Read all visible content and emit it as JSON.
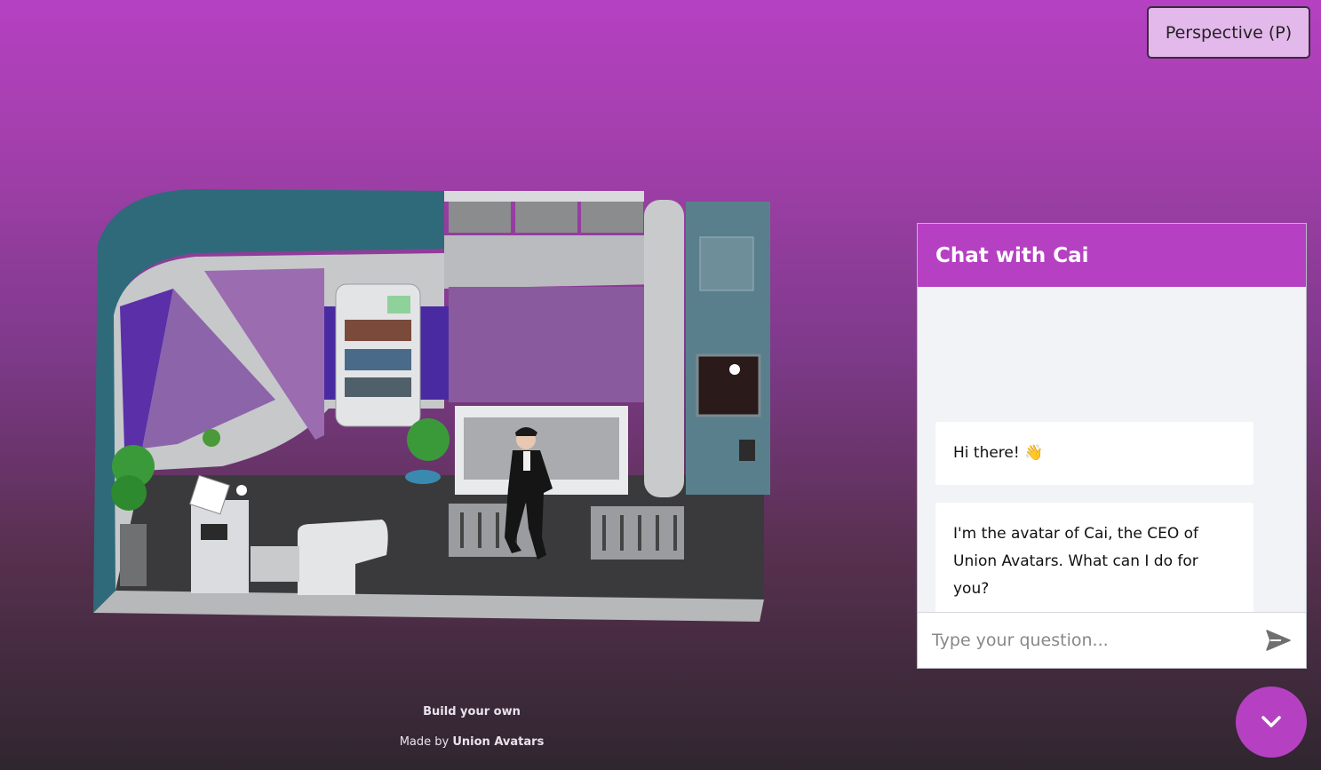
{
  "perspective_button": {
    "label": "Perspective (P)"
  },
  "chat": {
    "title": "Chat with Cai",
    "messages": [
      {
        "text": "Hi there! 👋"
      },
      {
        "text": "I'm the avatar of Cai, the CEO of Union Avatars. What can I do for you?"
      }
    ],
    "input_placeholder": "Type your question...",
    "input_value": ""
  },
  "footer": {
    "build_label": "Build your own",
    "made_by_prefix": "Made by ",
    "made_by_brand": "Union Avatars"
  },
  "icons": {
    "send": "send-icon",
    "collapse": "chevron-down-icon"
  },
  "colors": {
    "accent": "#b541c2",
    "button_bg": "#e3b8eb"
  }
}
